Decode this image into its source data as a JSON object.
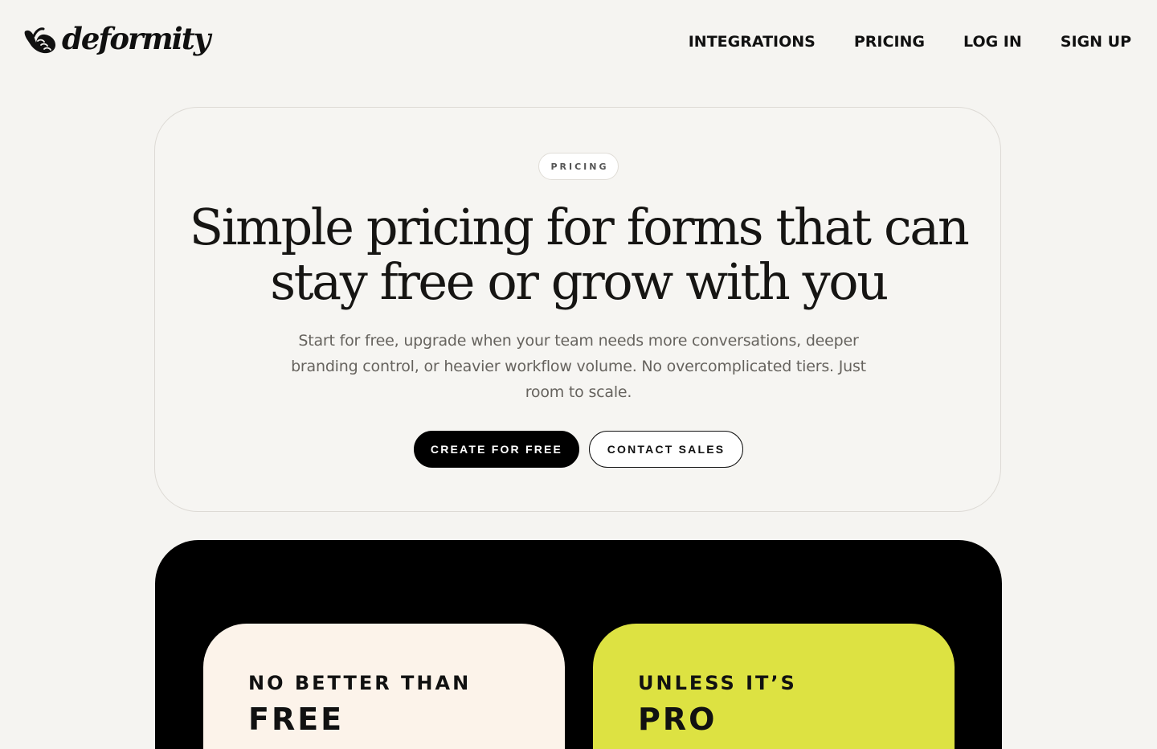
{
  "brand": {
    "name": "deformity",
    "logo_icon": "shaka-hand-icon"
  },
  "nav": {
    "links": [
      {
        "label": "INTEGRATIONS"
      },
      {
        "label": "PRICING"
      },
      {
        "label": "LOG IN"
      },
      {
        "label": "SIGN UP"
      }
    ]
  },
  "hero": {
    "eyebrow": "PRICING",
    "title": "Simple pricing for forms that can stay free or grow with you",
    "subtitle": "Start for free, upgrade when your team needs more conversations, deeper branding control, or heavier workflow volume. No overcomplicated tiers. Just room to scale.",
    "primary_button": "CREATE FOR FREE",
    "secondary_button": "CONTACT SALES"
  },
  "plans": [
    {
      "eyebrow": "NO BETTER THAN",
      "name": "FREE",
      "color": "#fcf3ea"
    },
    {
      "eyebrow": "UNLESS IT’S",
      "name": "PRO",
      "color": "#dde242"
    }
  ],
  "colors": {
    "background": "#f5f4f1",
    "ink": "#111111",
    "primary_button": "#000000",
    "accent": "#dde242"
  }
}
